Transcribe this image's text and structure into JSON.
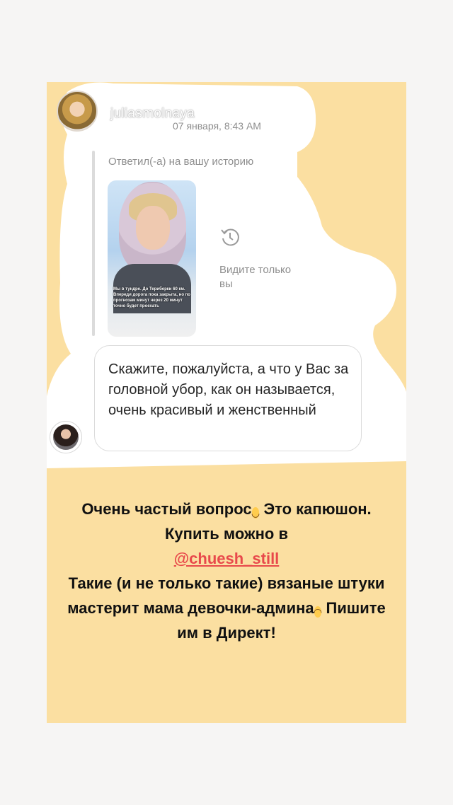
{
  "dm": {
    "username": "juliasmolnaya",
    "timestamp": "07 января, 8:43 AM",
    "reply_label": "Ответил(-а) на вашу историю",
    "story_caption": "Мы в тундре. До Териберки 60 км. Впереди дорога пока закрыта, но по прогнозам минут через 20 минут точно будет проехать",
    "hidden_note": "Видите только вы",
    "message": "Скажите, пожалуйста, а что у Вас за головной убор, как он называется, очень красивый и женственный"
  },
  "caption": {
    "line1_a": "Очень частый вопрос",
    "emoji1": "grinning-face-emoji",
    "line1_b": " Это капюшон. Купить можно в",
    "mention": "@chuesh_still",
    "line2": "Такие (и не только такие) вязаные штуки мастерит мама девочки-админа",
    "emoji2": "smiling-face-emoji",
    "line3": " Пишите им в Директ!"
  },
  "colors": {
    "story_bg": "#fbdfa1",
    "mention": "#e8494b"
  }
}
